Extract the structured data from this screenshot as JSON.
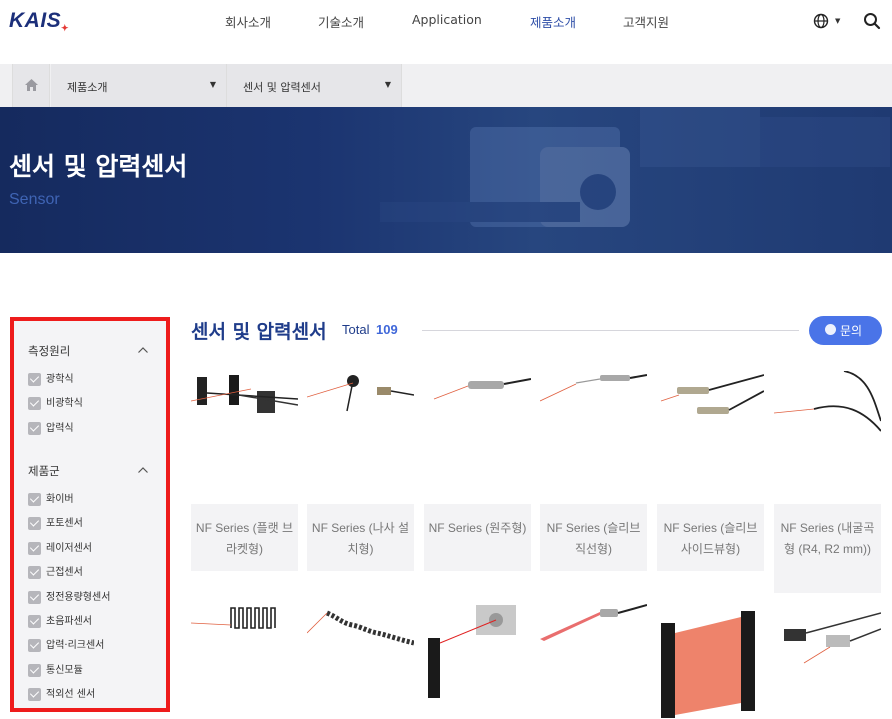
{
  "header": {
    "logo": "KAIS",
    "nav": [
      "회사소개",
      "기술소개",
      "Application",
      "제품소개",
      "고객지원"
    ],
    "active_nav": "제품소개",
    "icons": [
      "globe-icon",
      "search-icon"
    ]
  },
  "breadcrumb": {
    "level1": "제품소개",
    "level2": "센서 및 압력센서"
  },
  "banner": {
    "title": "센서 및 압력센서",
    "subtitle": "Sensor"
  },
  "sidebar": {
    "groups": [
      {
        "title": "측정원리",
        "options": [
          "광학식",
          "비광학식",
          "압력식"
        ]
      },
      {
        "title": "제품군",
        "options": [
          "화이버",
          "포토센서",
          "레이저센서",
          "근접센서",
          "정전용량형센서",
          "초음파센서",
          "압력·리크센서",
          "통신모듈",
          "적외선 센서"
        ]
      }
    ]
  },
  "main": {
    "title": "센서 및 압력센서",
    "total_label": "Total",
    "total_count": "109",
    "inquiry_button": "문의"
  },
  "products": [
    {
      "name": "NF Series (플랫 브라켓형)"
    },
    {
      "name": "NF Series (나사 설치형)"
    },
    {
      "name": "NF Series (원주형)"
    },
    {
      "name": "NF Series (슬리브 직선형)"
    },
    {
      "name": "NF Series (슬리브 사이드뷰형)"
    },
    {
      "name": "NF Series (내굴곡형 (R4, R2 mm))"
    }
  ],
  "colors": {
    "brand_navy": "#1c2f7a",
    "accent_blue": "#4a74e8",
    "highlight_red": "#ee1c1c"
  }
}
